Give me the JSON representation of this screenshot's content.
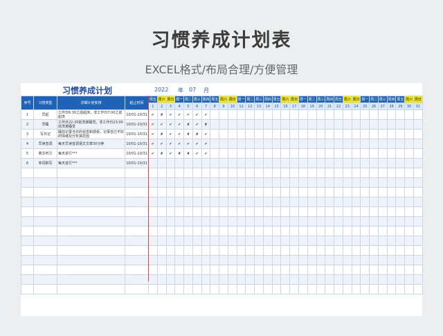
{
  "page_title": "习惯养成计划表",
  "subtitle": "EXCEL格式/布局合理/方便管理",
  "sheet": {
    "plan_title": "习惯养成计划",
    "year": "2022",
    "year_label": "年",
    "month": "07",
    "month_label": "月",
    "headers": {
      "no": "序号",
      "type": "习惯类型",
      "detail": "详细计划安排",
      "time": "起止时间"
    },
    "weekdays": [
      "周五",
      "周六",
      "周日",
      "周一",
      "周二",
      "周三",
      "周四",
      "周五",
      "周六",
      "周日",
      "周一",
      "周二",
      "周三",
      "周四",
      "周五",
      "周六",
      "周日",
      "周一",
      "周二",
      "周三",
      "周四",
      "周五",
      "周六",
      "周日",
      "周一",
      "周二",
      "周三",
      "周四",
      "周五",
      "周六",
      "周日"
    ],
    "days": [
      "1",
      "2",
      "3",
      "4",
      "5",
      "6",
      "7",
      "8",
      "9",
      "10",
      "11",
      "12",
      "13",
      "14",
      "15",
      "16",
      "17",
      "18",
      "19",
      "20",
      "21",
      "22",
      "23",
      "24",
      "25",
      "26",
      "27",
      "28",
      "29",
      "30",
      "31"
    ],
    "rows": [
      {
        "no": "1",
        "type": "早起",
        "detail": "工作日6:30之前起床，非工作日7:00之前起床",
        "time": "10/01-10/31",
        "marks": [
          "✔",
          "✘",
          "✔",
          "✔",
          "✔",
          "✔",
          "✔"
        ]
      },
      {
        "no": "2",
        "type": "早睡",
        "detail": "工作日22:30前洗漱睡觉，非工作日23:00前洗漱睡觉",
        "time": "10/01-10/31",
        "marks": [
          "✔",
          "✔",
          "✔",
          "✔",
          "✘",
          "✔",
          "✘"
        ]
      },
      {
        "no": "3",
        "type": "写日记",
        "detail": "睡前记录当日的状态和感受，记录自己不好的情绪及分析其原因",
        "time": "10/01-10/31",
        "marks": [
          "✔",
          "✘",
          "✔",
          "✔",
          "✘",
          "✘",
          "✔"
        ]
      },
      {
        "no": "4",
        "type": "早读音调",
        "detail": "每天早读音调语文文章30分钟",
        "time": "10/01-10/31",
        "marks": [
          "✔",
          "✔",
          "✔",
          "✔",
          "✔",
          "✔",
          "✔"
        ]
      },
      {
        "no": "5",
        "type": "英文听力",
        "detail": "每天进行***",
        "time": "10/01-10/31",
        "marks": [
          "✔",
          "✘",
          "✔",
          "✘",
          "✘",
          "✔",
          "✔"
        ]
      },
      {
        "no": "6",
        "type": "单词默写",
        "detail": "每天进行***",
        "time": "10/01-10/31",
        "marks": []
      }
    ],
    "empty_row_count": 13
  }
}
